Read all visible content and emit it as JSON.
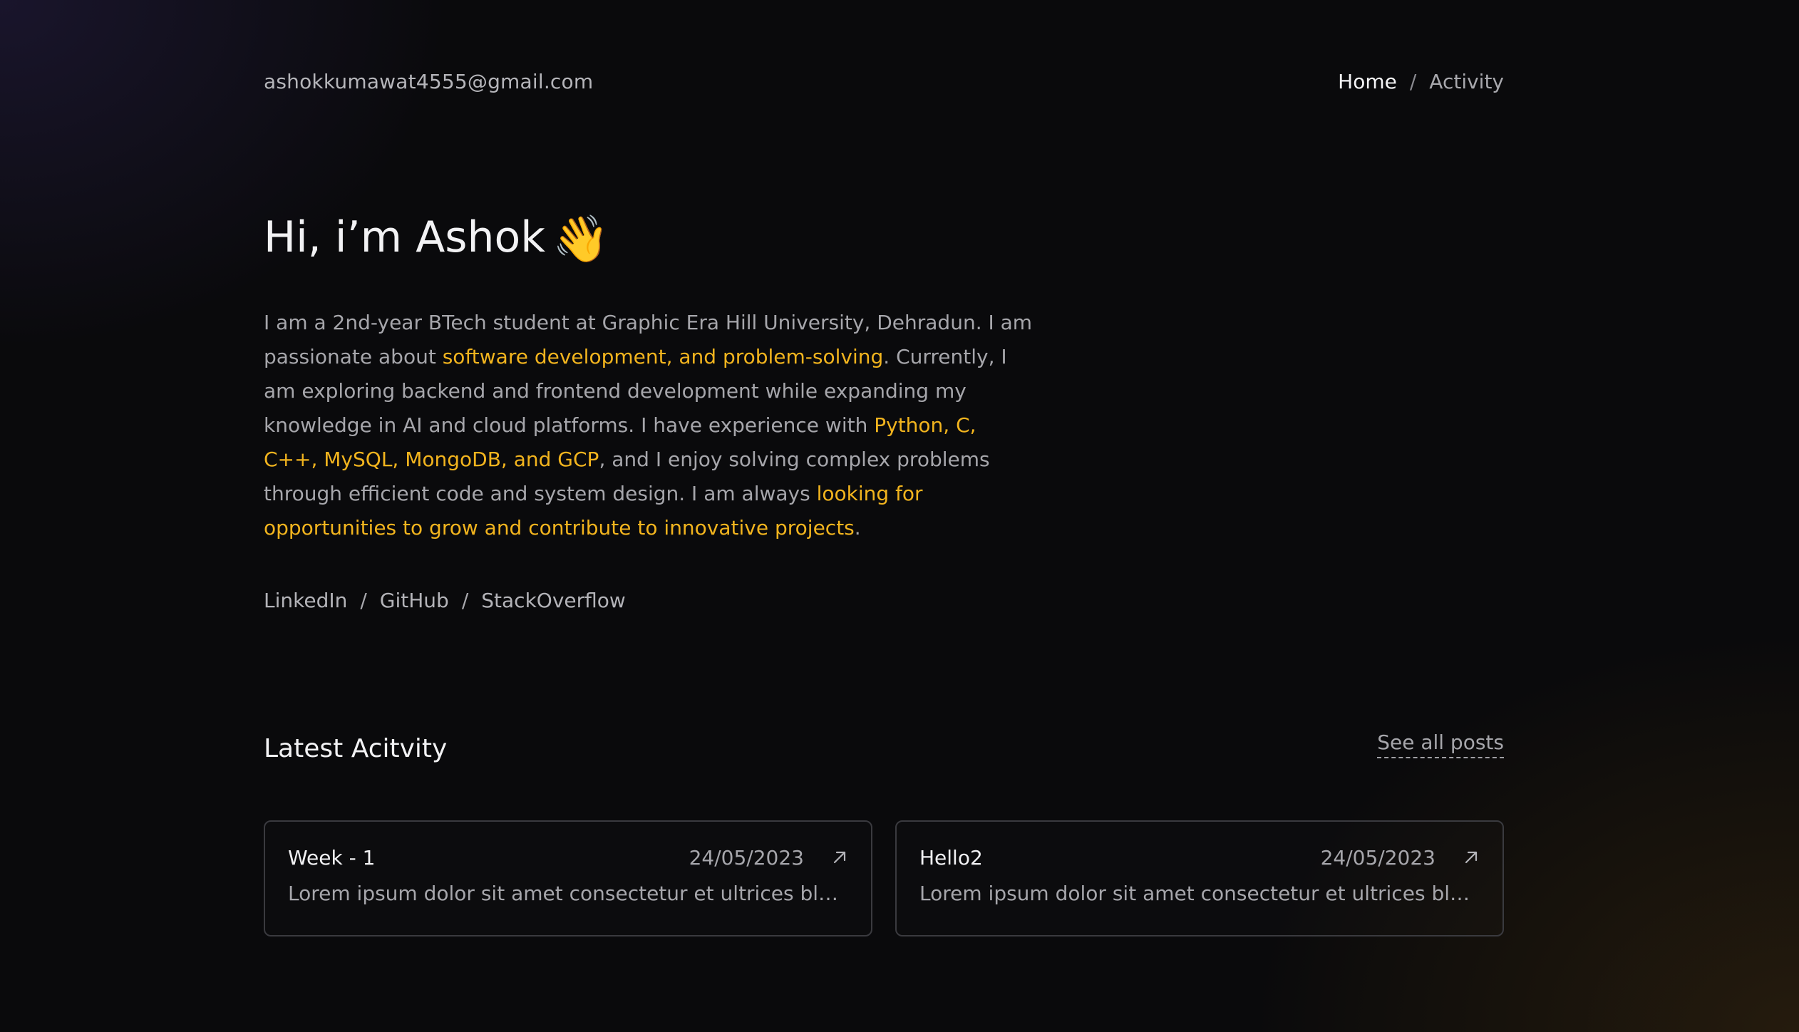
{
  "header": {
    "email": "ashokkumawat4555@gmail.com",
    "nav": {
      "home": "Home",
      "separator": "/",
      "activity": "Activity"
    }
  },
  "hero": {
    "greeting": "Hi, i’m Ashok",
    "wave_emoji": "👋",
    "bio": {
      "p1": "I am a 2nd-year BTech student at Graphic Era Hill University, Dehradun. I am passionate about ",
      "h1": "software development, and problem-solving",
      "p2": ". Currently, I am exploring backend and frontend development while expanding my knowledge in AI and cloud platforms. I have experience with ",
      "h2": "Python, C, C++, MySQL, MongoDB, and GCP",
      "p3": ", and I enjoy solving complex problems through efficient code and system design. I am always ",
      "h3": "looking for opportunities to grow and contribute to innovative projects",
      "p4": "."
    },
    "socials": {
      "linkedin": "LinkedIn",
      "github": "GitHub",
      "stackoverflow": "StackOverflow",
      "separator": "/"
    }
  },
  "activity": {
    "title": "Latest Acitvity",
    "see_all": "See all posts",
    "cards": [
      {
        "title": "Week - 1",
        "date": "24/05/2023",
        "excerpt": "Lorem ipsum dolor sit amet consectetur et ultrices blandit ...",
        "icon": "arrow-up-right-icon"
      },
      {
        "title": "Hello2",
        "date": "24/05/2023",
        "excerpt": "Lorem ipsum dolor sit amet consectetur et ultrices blandit ...",
        "icon": "arrow-up-right-icon"
      }
    ]
  },
  "colors": {
    "background": "#0a0a0c",
    "highlight": "#f2b41e",
    "text": "#a6a6ab",
    "heading": "#f2f2f4",
    "card_border": "#3a3a3f"
  }
}
